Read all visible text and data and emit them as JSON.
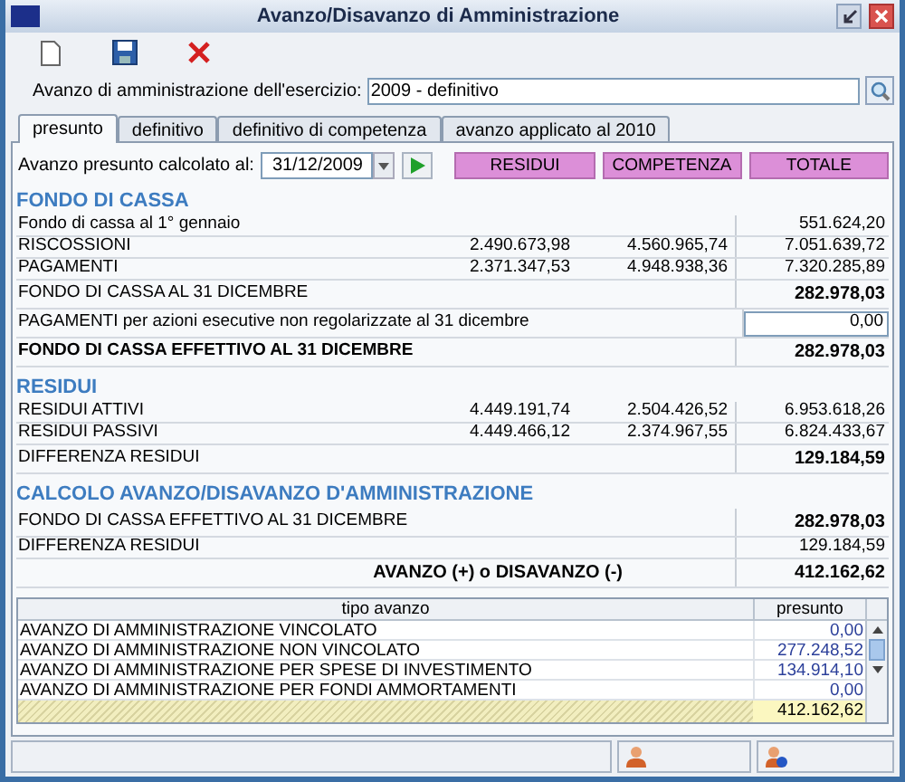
{
  "window": {
    "title": "Avanzo/Disavanzo di Amministrazione"
  },
  "exercise_field": {
    "label": "Avanzo di amministrazione dell'esercizio:",
    "value": "2009 - definitivo"
  },
  "tabs": [
    {
      "label": "presunto",
      "selected": true
    },
    {
      "label": "definitivo",
      "selected": false
    },
    {
      "label": "definitivo di competenza",
      "selected": false
    },
    {
      "label": "avanzo applicato al 2010",
      "selected": false
    }
  ],
  "date_row": {
    "label": "Avanzo presunto calcolato al:",
    "value": "31/12/2009"
  },
  "column_headers": [
    "RESIDUI",
    "COMPETENZA",
    "TOTALE"
  ],
  "sections": [
    {
      "title": "FONDO DI CASSA",
      "rows": [
        {
          "kind": "line",
          "label": "Fondo di cassa al 1° gennaio",
          "totale": "551.624,20"
        },
        {
          "kind": "line",
          "label": "RISCOSSIONI",
          "residui": "2.490.673,98",
          "competenza": "4.560.965,74",
          "totale": "7.051.639,72"
        },
        {
          "kind": "line",
          "label": "PAGAMENTI",
          "residui": "2.371.347,53",
          "competenza": "4.948.938,36",
          "totale": "7.320.285,89"
        },
        {
          "kind": "subtotal",
          "label": "FONDO DI CASSA AL 31 DICEMBRE",
          "totale": "282.978,03"
        },
        {
          "kind": "input",
          "label": "PAGAMENTI per azioni esecutive non regolarizzate al 31 dicembre",
          "totale": "0,00"
        },
        {
          "kind": "grand",
          "label": "FONDO DI CASSA EFFETTIVO AL 31 DICEMBRE",
          "totale": "282.978,03"
        }
      ]
    },
    {
      "title": "RESIDUI",
      "rows": [
        {
          "kind": "line",
          "label": "RESIDUI ATTIVI",
          "residui": "4.449.191,74",
          "competenza": "2.504.426,52",
          "totale": "6.953.618,26"
        },
        {
          "kind": "line",
          "label": "RESIDUI PASSIVI",
          "residui": "4.449.466,12",
          "competenza": "2.374.967,55",
          "totale": "6.824.433,67"
        },
        {
          "kind": "subtotal",
          "label": "DIFFERENZA RESIDUI",
          "totale": "129.184,59"
        }
      ]
    },
    {
      "title": "CALCOLO AVANZO/DISAVANZO D'AMMINISTRAZIONE",
      "rows": [
        {
          "kind": "subtotal",
          "label": "FONDO DI CASSA EFFETTIVO AL 31 DICEMBRE",
          "totale": "282.978,03"
        },
        {
          "kind": "line",
          "label": "DIFFERENZA RESIDUI",
          "totale": "129.184,59"
        }
      ]
    }
  ],
  "result": {
    "label": "AVANZO (+) o DISAVANZO (-)",
    "value": "412.162,62"
  },
  "table": {
    "columns": [
      "tipo avanzo",
      "presunto"
    ],
    "rows": [
      {
        "label": "AVANZO DI AMMINISTRAZIONE VINCOLATO",
        "value": "0,00"
      },
      {
        "label": "AVANZO DI AMMINISTRAZIONE NON VINCOLATO",
        "value": "277.248,52"
      },
      {
        "label": "AVANZO DI AMMINISTRAZIONE PER SPESE DI INVESTIMENTO",
        "value": "134.914,10"
      },
      {
        "label": "AVANZO DI AMMINISTRAZIONE PER FONDI AMMORTAMENTI",
        "value": "0,00"
      }
    ],
    "total": "412.162,62"
  }
}
